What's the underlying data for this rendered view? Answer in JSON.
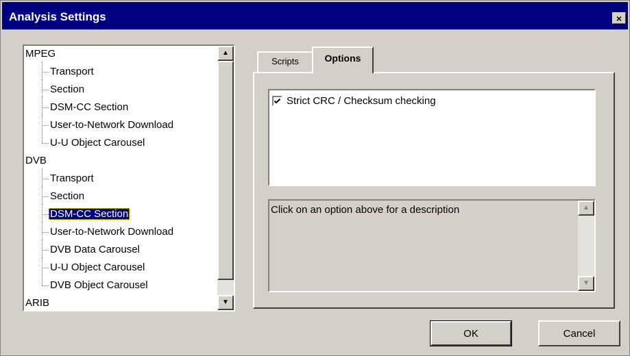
{
  "window": {
    "title": "Analysis Settings",
    "close_glyph": "×",
    "close_icon": "close-icon"
  },
  "tree": {
    "items": [
      {
        "label": "MPEG",
        "level": 0
      },
      {
        "label": "Transport",
        "level": 1
      },
      {
        "label": "Section",
        "level": 1
      },
      {
        "label": "DSM-CC Section",
        "level": 1
      },
      {
        "label": "User-to-Network Download",
        "level": 1
      },
      {
        "label": "U-U Object Carousel",
        "level": 1,
        "last": true
      },
      {
        "label": "DVB",
        "level": 0
      },
      {
        "label": "Transport",
        "level": 1
      },
      {
        "label": "Section",
        "level": 1
      },
      {
        "label": "DSM-CC Section",
        "level": 1,
        "selected": true
      },
      {
        "label": "User-to-Network Download",
        "level": 1
      },
      {
        "label": "DVB Data Carousel",
        "level": 1
      },
      {
        "label": "U-U Object Carousel",
        "level": 1
      },
      {
        "label": "DVB Object Carousel",
        "level": 1,
        "last": true
      },
      {
        "label": "ARIB",
        "level": 0
      }
    ],
    "scroll_up_glyph": "▲",
    "scroll_down_glyph": "▼",
    "scroll_position": 0.0
  },
  "tabs": [
    {
      "label": "Scripts",
      "active": false
    },
    {
      "label": "Options",
      "active": true
    }
  ],
  "options": [
    {
      "label": "Strict CRC / Checksum checking",
      "checked": true
    }
  ],
  "description": {
    "text": "Click on an option above for a description",
    "scroll_up_glyph": "▲",
    "scroll_down_glyph": "▼"
  },
  "buttons": {
    "ok": "OK",
    "cancel": "Cancel"
  },
  "colors": {
    "titlebar": "#000080",
    "dialog_bg": "#d4d0c8",
    "selection": "#000080"
  }
}
